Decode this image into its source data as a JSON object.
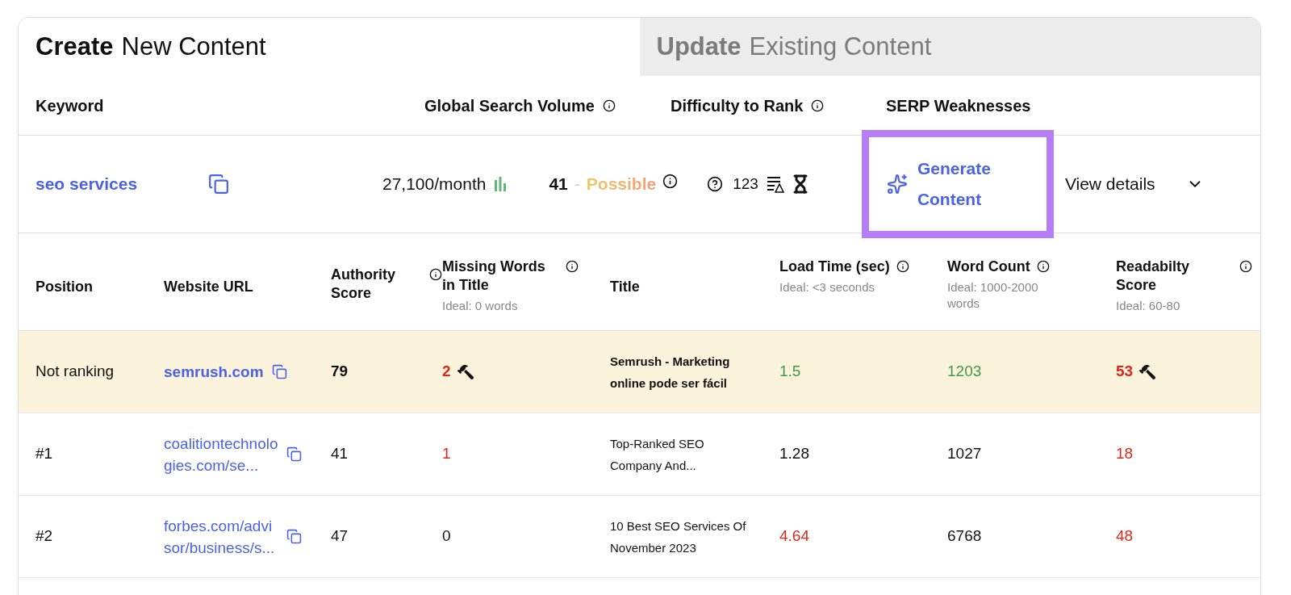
{
  "tabs": [
    {
      "bold": "Create",
      "rest": "New Content",
      "selected": true
    },
    {
      "bold": "Update",
      "rest": "Existing Content",
      "selected": false
    }
  ],
  "keyword_header": [
    {
      "label": "Keyword",
      "info": false
    },
    {
      "label": "Global Search Volume",
      "info": true
    },
    {
      "label": "Difficulty to Rank",
      "info": true
    },
    {
      "label": "SERP Weaknesses",
      "info": false
    }
  ],
  "keyword_row": {
    "keyword": "seo services",
    "volume": "27,100/month",
    "difficulty": "41",
    "difficulty_separator": "-",
    "difficulty_label": "Possible",
    "serp_count": "123",
    "generate_button": "Generate Content",
    "generate_highlighted": true,
    "view_details": "View details",
    "expanded": false
  },
  "table": {
    "columns": [
      {
        "label": "Position",
        "info": false
      },
      {
        "label": "Website URL",
        "info": false
      },
      {
        "label": "Authority Score",
        "info": true
      },
      {
        "label": "Missing Words in Title",
        "info": true,
        "hint": "Ideal: 0 words"
      },
      {
        "label": "Title",
        "info": false
      },
      {
        "label": "Load Time (sec)",
        "info": true,
        "hint": "Ideal: <3 seconds"
      },
      {
        "label": "Word Count",
        "info": true,
        "hint": "Ideal: 1000-2000 words"
      },
      {
        "label": "Readabilty Score",
        "info": true,
        "hint": "Ideal: 60-80"
      }
    ],
    "rows": [
      {
        "highlighted": true,
        "position": "Not ranking",
        "url": "semrush.com",
        "authority": "79",
        "missing": {
          "text": "2",
          "color": "#e0261b",
          "fix": true
        },
        "title": "Semrush - Marketing online pode ser fácil",
        "load": {
          "text": "1.5",
          "color": "#3d9a44"
        },
        "words": {
          "text": "1203",
          "color": "#3d9a44"
        },
        "readability": {
          "text": "53",
          "color": "#e0261b",
          "fix": true
        }
      },
      {
        "highlighted": false,
        "position": "#1",
        "url": "coalitiontechnologies.com/se...",
        "authority": "41",
        "missing": {
          "text": "1",
          "color": "#e0261b",
          "fix": false
        },
        "title": "Top-Ranked SEO Company And...",
        "load": {
          "text": "1.28",
          "color": "#111111"
        },
        "words": {
          "text": "1027",
          "color": "#111111"
        },
        "readability": {
          "text": "18",
          "color": "#e0261b",
          "fix": false
        }
      },
      {
        "highlighted": false,
        "position": "#2",
        "url": "forbes.com/advisor/business/s...",
        "authority": "47",
        "missing": {
          "text": "0",
          "color": "#111111",
          "fix": false
        },
        "title": "10 Best SEO Services Of November 2023",
        "load": {
          "text": "4.64",
          "color": "#e0261b"
        },
        "words": {
          "text": "6768",
          "color": "#111111"
        },
        "readability": {
          "text": "48",
          "color": "#e0261b",
          "fix": false
        }
      }
    ]
  }
}
